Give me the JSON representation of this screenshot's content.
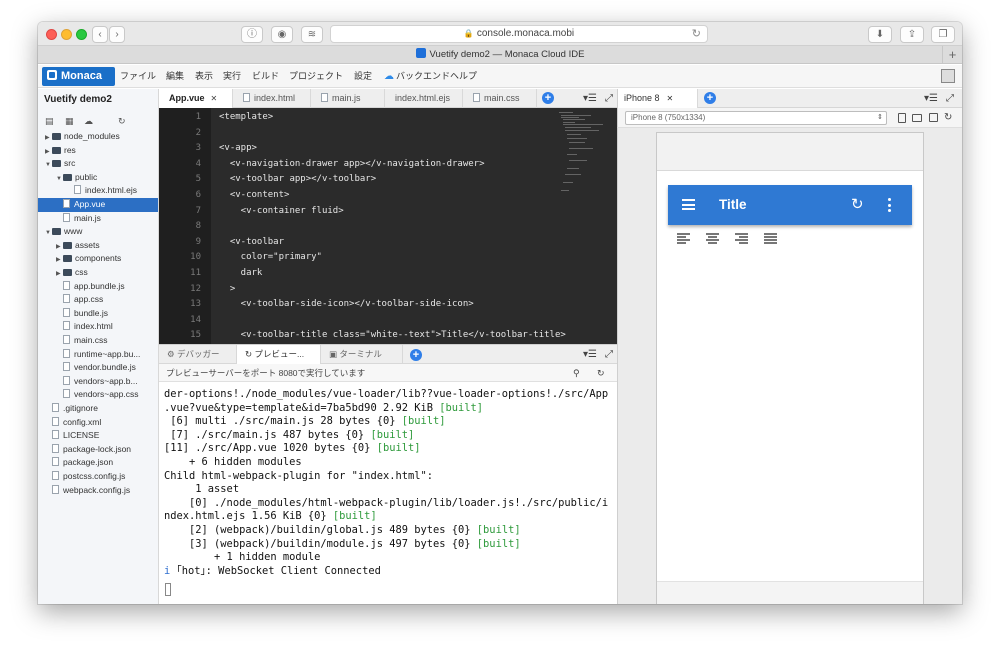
{
  "browser": {
    "url": "console.monaca.mobi",
    "tab_title": "Vuetify demo2 — Monaca Cloud IDE"
  },
  "menubar": {
    "logo": "Monaca",
    "items": [
      "ファイル",
      "編集",
      "表示",
      "実行",
      "ビルド",
      "プロジェクト",
      "設定",
      "バックエンド",
      "ヘルプ"
    ]
  },
  "sidebar": {
    "project_title": "Vuetify demo2",
    "tree": [
      {
        "label": "node_modules",
        "type": "folder",
        "indent": 0,
        "arrow": "▶"
      },
      {
        "label": "res",
        "type": "folder",
        "indent": 0,
        "arrow": "▶"
      },
      {
        "label": "src",
        "type": "folder",
        "indent": 0,
        "arrow": "▼"
      },
      {
        "label": "public",
        "type": "folder",
        "indent": 1,
        "arrow": "▼"
      },
      {
        "label": "index.html.ejs",
        "type": "file",
        "indent": 2,
        "arrow": ""
      },
      {
        "label": "App.vue",
        "type": "file",
        "indent": 1,
        "arrow": "",
        "selected": true
      },
      {
        "label": "main.js",
        "type": "file",
        "indent": 1,
        "arrow": ""
      },
      {
        "label": "www",
        "type": "folder",
        "indent": 0,
        "arrow": "▼"
      },
      {
        "label": "assets",
        "type": "folder",
        "indent": 1,
        "arrow": "▶"
      },
      {
        "label": "components",
        "type": "folder",
        "indent": 1,
        "arrow": "▶"
      },
      {
        "label": "css",
        "type": "folder",
        "indent": 1,
        "arrow": "▶"
      },
      {
        "label": "app.bundle.js",
        "type": "file",
        "indent": 1,
        "arrow": ""
      },
      {
        "label": "app.css",
        "type": "file",
        "indent": 1,
        "arrow": ""
      },
      {
        "label": "bundle.js",
        "type": "file",
        "indent": 1,
        "arrow": ""
      },
      {
        "label": "index.html",
        "type": "file",
        "indent": 1,
        "arrow": ""
      },
      {
        "label": "main.css",
        "type": "file",
        "indent": 1,
        "arrow": ""
      },
      {
        "label": "runtime~app.bu...",
        "type": "file",
        "indent": 1,
        "arrow": ""
      },
      {
        "label": "vendor.bundle.js",
        "type": "file",
        "indent": 1,
        "arrow": ""
      },
      {
        "label": "vendors~app.b...",
        "type": "file",
        "indent": 1,
        "arrow": ""
      },
      {
        "label": "vendors~app.css",
        "type": "file",
        "indent": 1,
        "arrow": ""
      },
      {
        "label": ".gitignore",
        "type": "file",
        "indent": 0,
        "arrow": ""
      },
      {
        "label": "config.xml",
        "type": "file",
        "indent": 0,
        "arrow": ""
      },
      {
        "label": "LICENSE",
        "type": "file",
        "indent": 0,
        "arrow": ""
      },
      {
        "label": "package-lock.json",
        "type": "file",
        "indent": 0,
        "arrow": ""
      },
      {
        "label": "package.json",
        "type": "file",
        "indent": 0,
        "arrow": ""
      },
      {
        "label": "postcss.config.js",
        "type": "file",
        "indent": 0,
        "arrow": ""
      },
      {
        "label": "webpack.config.js",
        "type": "file",
        "indent": 0,
        "arrow": ""
      }
    ]
  },
  "editor": {
    "tabs": [
      "App.vue",
      "index.html",
      "main.js",
      "index.html.ejs",
      "main.css"
    ],
    "lines": [
      {
        "n": "1",
        "text": "<template>"
      },
      {
        "n": "2",
        "text": ""
      },
      {
        "n": "3",
        "text": "<v-app>"
      },
      {
        "n": "4",
        "text": "  <v-navigation-drawer app></v-navigation-drawer>"
      },
      {
        "n": "5",
        "text": "  <v-toolbar app></v-toolbar>"
      },
      {
        "n": "6",
        "text": "  <v-content>"
      },
      {
        "n": "7",
        "text": "    <v-container fluid>"
      },
      {
        "n": "8",
        "text": ""
      },
      {
        "n": "9",
        "text": "  <v-toolbar"
      },
      {
        "n": "10",
        "text": "    color=\"primary\""
      },
      {
        "n": "11",
        "text": "    dark"
      },
      {
        "n": "12",
        "text": "  >"
      },
      {
        "n": "13",
        "text": "    <v-toolbar-side-icon></v-toolbar-side-icon>"
      },
      {
        "n": "14",
        "text": ""
      },
      {
        "n": "15",
        "text": "    <v-toolbar-title class=\"white--text\">Title</v-toolbar-title>"
      }
    ]
  },
  "bottom_panel": {
    "tabs": [
      "デバッガー",
      "プレビュー...",
      "ターミナル"
    ],
    "status": "プレビューサーバーをポート 8080で実行しています",
    "terminal": [
      [
        {
          "t": "der-options!./node_modules/vue-loader/lib??vue-loader-options!./src/App"
        }
      ],
      [
        {
          "t": ".vue?vue&type=template&id=7ba5bd90 2.92 KiB "
        },
        {
          "t": "[built]",
          "c": "built"
        }
      ],
      [
        {
          "t": " [6] multi ./src/main.js 28 bytes {0} "
        },
        {
          "t": "[built]",
          "c": "built"
        }
      ],
      [
        {
          "t": " [7] ./src/main.js 487 bytes {0} "
        },
        {
          "t": "[built]",
          "c": "built"
        }
      ],
      [
        {
          "t": "[11] ./src/App.vue 1020 bytes {0} "
        },
        {
          "t": "[built]",
          "c": "built"
        }
      ],
      [
        {
          "t": "    + 6 hidden modules"
        }
      ],
      [
        {
          "t": "Child html-webpack-plugin for \"index.html\":"
        }
      ],
      [
        {
          "t": "     1 asset"
        }
      ],
      [
        {
          "t": "    [0] ./node_modules/html-webpack-plugin/lib/loader.js!./src/public/i"
        }
      ],
      [
        {
          "t": "ndex.html.ejs 1.56 KiB {0} "
        },
        {
          "t": "[built]",
          "c": "built"
        }
      ],
      [
        {
          "t": "    [2] (webpack)/buildin/global.js 489 bytes {0} "
        },
        {
          "t": "[built]",
          "c": "built"
        }
      ],
      [
        {
          "t": "    [3] (webpack)/buildin/module.js 497 bytes {0} "
        },
        {
          "t": "[built]",
          "c": "built"
        }
      ],
      [
        {
          "t": "        + 1 hidden module"
        }
      ],
      [
        {
          "t": "i ",
          "c": "info"
        },
        {
          "t": "｢hot｣: WebSocket Client Connected"
        }
      ]
    ]
  },
  "preview": {
    "tab_label": "iPhone 8",
    "device_select": "iPhone 8 (750x1334)",
    "app_title": "Title"
  }
}
